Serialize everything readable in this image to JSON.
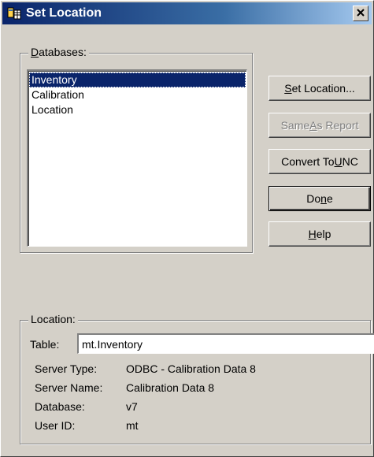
{
  "window": {
    "title": "Set Location",
    "close_glyph": "✕"
  },
  "databases": {
    "label": "Databases:",
    "label_mnemonic": "D",
    "label_rest": "atabases:",
    "items": [
      {
        "label": "Inventory",
        "selected": true
      },
      {
        "label": "Calibration",
        "selected": false
      },
      {
        "label": "Location",
        "selected": false
      }
    ]
  },
  "buttons": {
    "set_location": {
      "pre": "",
      "mn": "S",
      "post": "et Location...",
      "enabled": true
    },
    "same_as_report": {
      "pre": "Same ",
      "mn": "A",
      "post": "s Report",
      "enabled": false
    },
    "convert_to_unc": {
      "pre": "Convert To ",
      "mn": "U",
      "post": "NC",
      "enabled": true
    },
    "done": {
      "pre": "Do",
      "mn": "n",
      "post": "e",
      "enabled": true
    },
    "help": {
      "pre": "",
      "mn": "H",
      "post": "elp",
      "enabled": true
    }
  },
  "location": {
    "label": "Location:",
    "table_label": "Table:",
    "table_value": "mt.Inventory",
    "info": [
      {
        "key": "Server Type:",
        "value": "ODBC - Calibration Data 8"
      },
      {
        "key": "Server Name:",
        "value": "Calibration Data 8"
      },
      {
        "key": "Database:",
        "value": "v7"
      },
      {
        "key": "User ID:",
        "value": "mt"
      }
    ]
  },
  "icons": {
    "app": "database-table-icon",
    "close": "close-icon"
  },
  "colors": {
    "titlebar_start": "#0a246a",
    "titlebar_end": "#a6caf0",
    "selection": "#0a246a",
    "face": "#d4d0c8"
  }
}
